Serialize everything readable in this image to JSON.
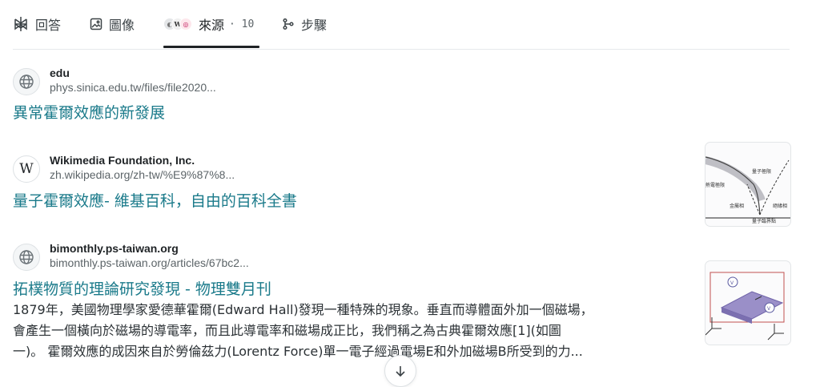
{
  "tabs": {
    "answer": "回答",
    "images": "圖像",
    "sources": "來源",
    "sources_count": "· 10",
    "steps": "步驟"
  },
  "results": [
    {
      "source_name": "edu",
      "url": "phys.sinica.edu.tw/files/file2020...",
      "title": "異常霍爾效應的新發展",
      "favicon_icon": "globe-icon"
    },
    {
      "source_name": "Wikimedia Foundation, Inc.",
      "url": "zh.wikipedia.org/zh-tw/%E9%87%8...",
      "title": "量子霍爾效應- 維基百科，自由的百科全書",
      "favicon_icon": "wikipedia-icon",
      "favicon_letter": "W",
      "thumbnail_labels": [
        "量子極限",
        "熱電極限",
        "金屬相",
        "絕緣相",
        "量子臨界點"
      ]
    },
    {
      "source_name": "bimonthly.ps-taiwan.org",
      "url": "bimonthly.ps-taiwan.org/articles/67bc2...",
      "title": "拓樸物質的理論研究發現 - 物理雙月刊",
      "favicon_icon": "globe-icon",
      "snippet_lines": [
        "1879年，美國物理學家愛德華霍爾(Edward Hall)發現一種特殊的現象。垂直而導體面外加一個磁場，",
        "會產生一個橫向於磁場的導電率，而且此導電率和磁場成正比，我們稱之為古典霍爾效應[1](如圖",
        "一)。 霍爾效應的成因來自於勞倫茲力(Lorentz Force)單一電子經過電場E和外加磁場B所受到的力..."
      ]
    }
  ],
  "colors": {
    "link": "#1a7a8a",
    "tab_underline": "#1f2326",
    "divider": "#e6e9ec"
  }
}
